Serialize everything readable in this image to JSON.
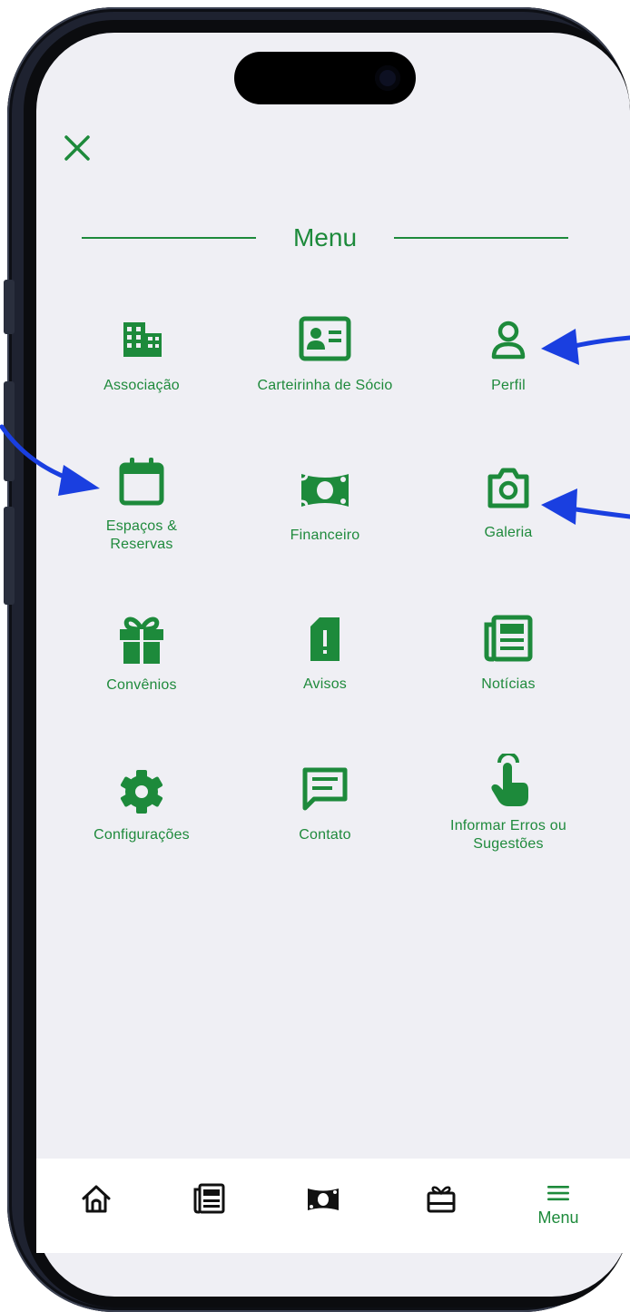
{
  "header": {
    "close_icon": "close-icon",
    "title": "Menu"
  },
  "menu_items": [
    {
      "label": "Associação",
      "icon": "building-icon"
    },
    {
      "label": "Carteirinha de Sócio",
      "icon": "id-card-icon"
    },
    {
      "label": "Perfil",
      "icon": "user-icon"
    },
    {
      "label": "Espaços &",
      "label2": "Reservas",
      "icon": "calendar-icon"
    },
    {
      "label": "Financeiro",
      "icon": "money-icon"
    },
    {
      "label": "Galeria",
      "icon": "camera-icon"
    },
    {
      "label": "Convênios",
      "icon": "gift-icon"
    },
    {
      "label": "Avisos",
      "icon": "alert-icon"
    },
    {
      "label": "Notícias",
      "icon": "newspaper-icon"
    },
    {
      "label": "Configurações",
      "icon": "gear-icon"
    },
    {
      "label": "Contato",
      "icon": "message-icon"
    },
    {
      "label": "Informar Erros ou",
      "label2": "Sugestões",
      "icon": "tap-hand-icon"
    }
  ],
  "tabbar": {
    "tabs": [
      {
        "icon": "home-icon"
      },
      {
        "icon": "newspaper-icon"
      },
      {
        "icon": "money-icon"
      },
      {
        "icon": "gift-card-icon"
      },
      {
        "icon": "hamburger-menu-icon",
        "label": "Menu"
      }
    ]
  },
  "colors": {
    "accent": "#1d8a3b",
    "background": "#efeff4",
    "annotation_arrow": "#1a3fe0"
  }
}
